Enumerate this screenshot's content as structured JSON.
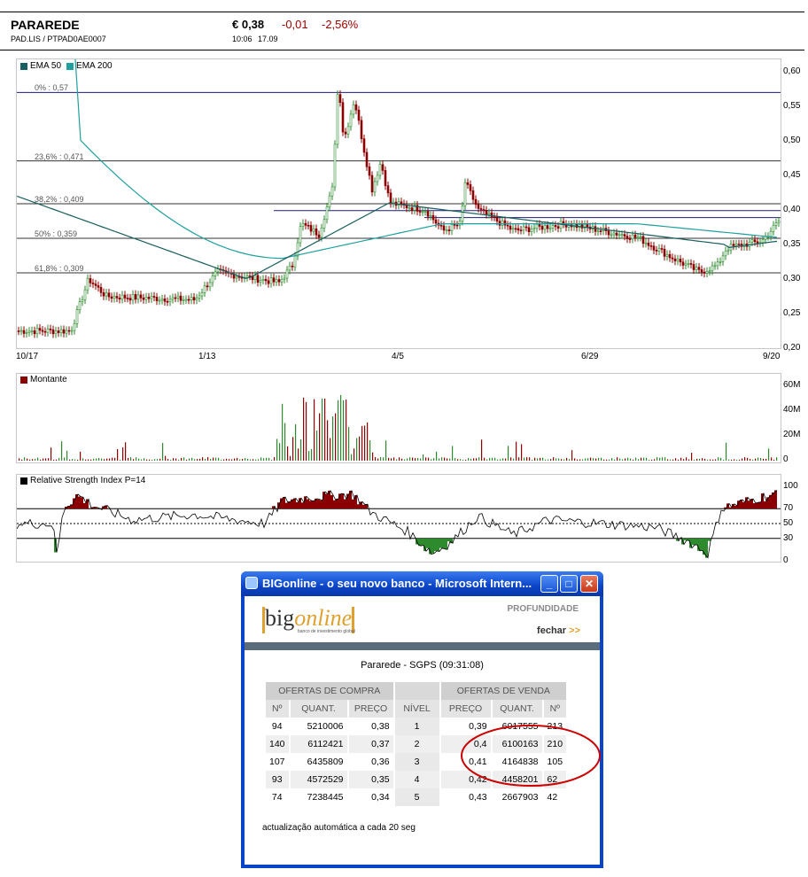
{
  "header": {
    "name": "PARAREDE",
    "code": "PAD.LIS  /  PTPAD0AE0007",
    "price": "€ 0,38",
    "change": "-0,01",
    "change_pct": "-2,56%",
    "time": "10:06",
    "date": "17.09"
  },
  "colors": {
    "up": "#2d8a2d",
    "down": "#8b0000",
    "ema50": "#1a5f5f",
    "ema200": "#1f9f9f",
    "rsi": "#000000"
  },
  "price_chart": {
    "legend": [
      {
        "label": "EMA 50",
        "color": "#1a5f5f"
      },
      {
        "label": "EMA 200",
        "color": "#1f9f9f"
      }
    ],
    "y_ticks": [
      "0,60",
      "0,55",
      "0,50",
      "0,45",
      "0,40",
      "0,35",
      "0,30",
      "0,25",
      "0,20"
    ],
    "x_ticks": [
      "10/17",
      "1/13",
      "4/5",
      "6/29",
      "9/20"
    ],
    "fib_labels": [
      "0% : 0,57",
      "23,6% : 0,471",
      "38,2% : 0,409",
      "50% : 0,359",
      "61,8% : 0,309"
    ]
  },
  "volume_chart": {
    "legend": "Montante",
    "y_ticks": [
      "60M",
      "40M",
      "20M",
      "0"
    ]
  },
  "rsi_chart": {
    "legend": "Relative Strength Index P=14",
    "y_ticks": [
      "100",
      "70",
      "50",
      "30",
      "0"
    ]
  },
  "popup": {
    "title": "BIGonline - o seu novo banco - Microsoft Intern...",
    "logo_big": "big",
    "logo_online": "online",
    "logo_sub": "banco de investimento global",
    "profundidade": "PROFUNDIDADE",
    "fechar": "fechar",
    "fechar_arrow": ">>",
    "book_title": "Pararede - SGPS  (09:31:08)",
    "group_buy": "OFERTAS DE COMPRA",
    "group_sell": "OFERTAS DE VENDA",
    "columns": [
      "Nº",
      "QUANT.",
      "PREÇO",
      "NÍVEL",
      "PREÇO",
      "QUANT.",
      "Nº"
    ],
    "rows": [
      [
        "94",
        "5210006",
        "0,38",
        "1",
        "0,39",
        "6017555",
        "213"
      ],
      [
        "140",
        "6112421",
        "0,37",
        "2",
        "0,4",
        "6100163",
        "210"
      ],
      [
        "107",
        "6435809",
        "0,36",
        "3",
        "0,41",
        "4164838",
        "105"
      ],
      [
        "93",
        "4572529",
        "0,35",
        "4",
        "0,42",
        "4458201",
        "62"
      ],
      [
        "74",
        "7238445",
        "0,34",
        "5",
        "0,43",
        "2667903",
        "42"
      ]
    ],
    "note": "actualização automática a cada 20 seg"
  }
}
